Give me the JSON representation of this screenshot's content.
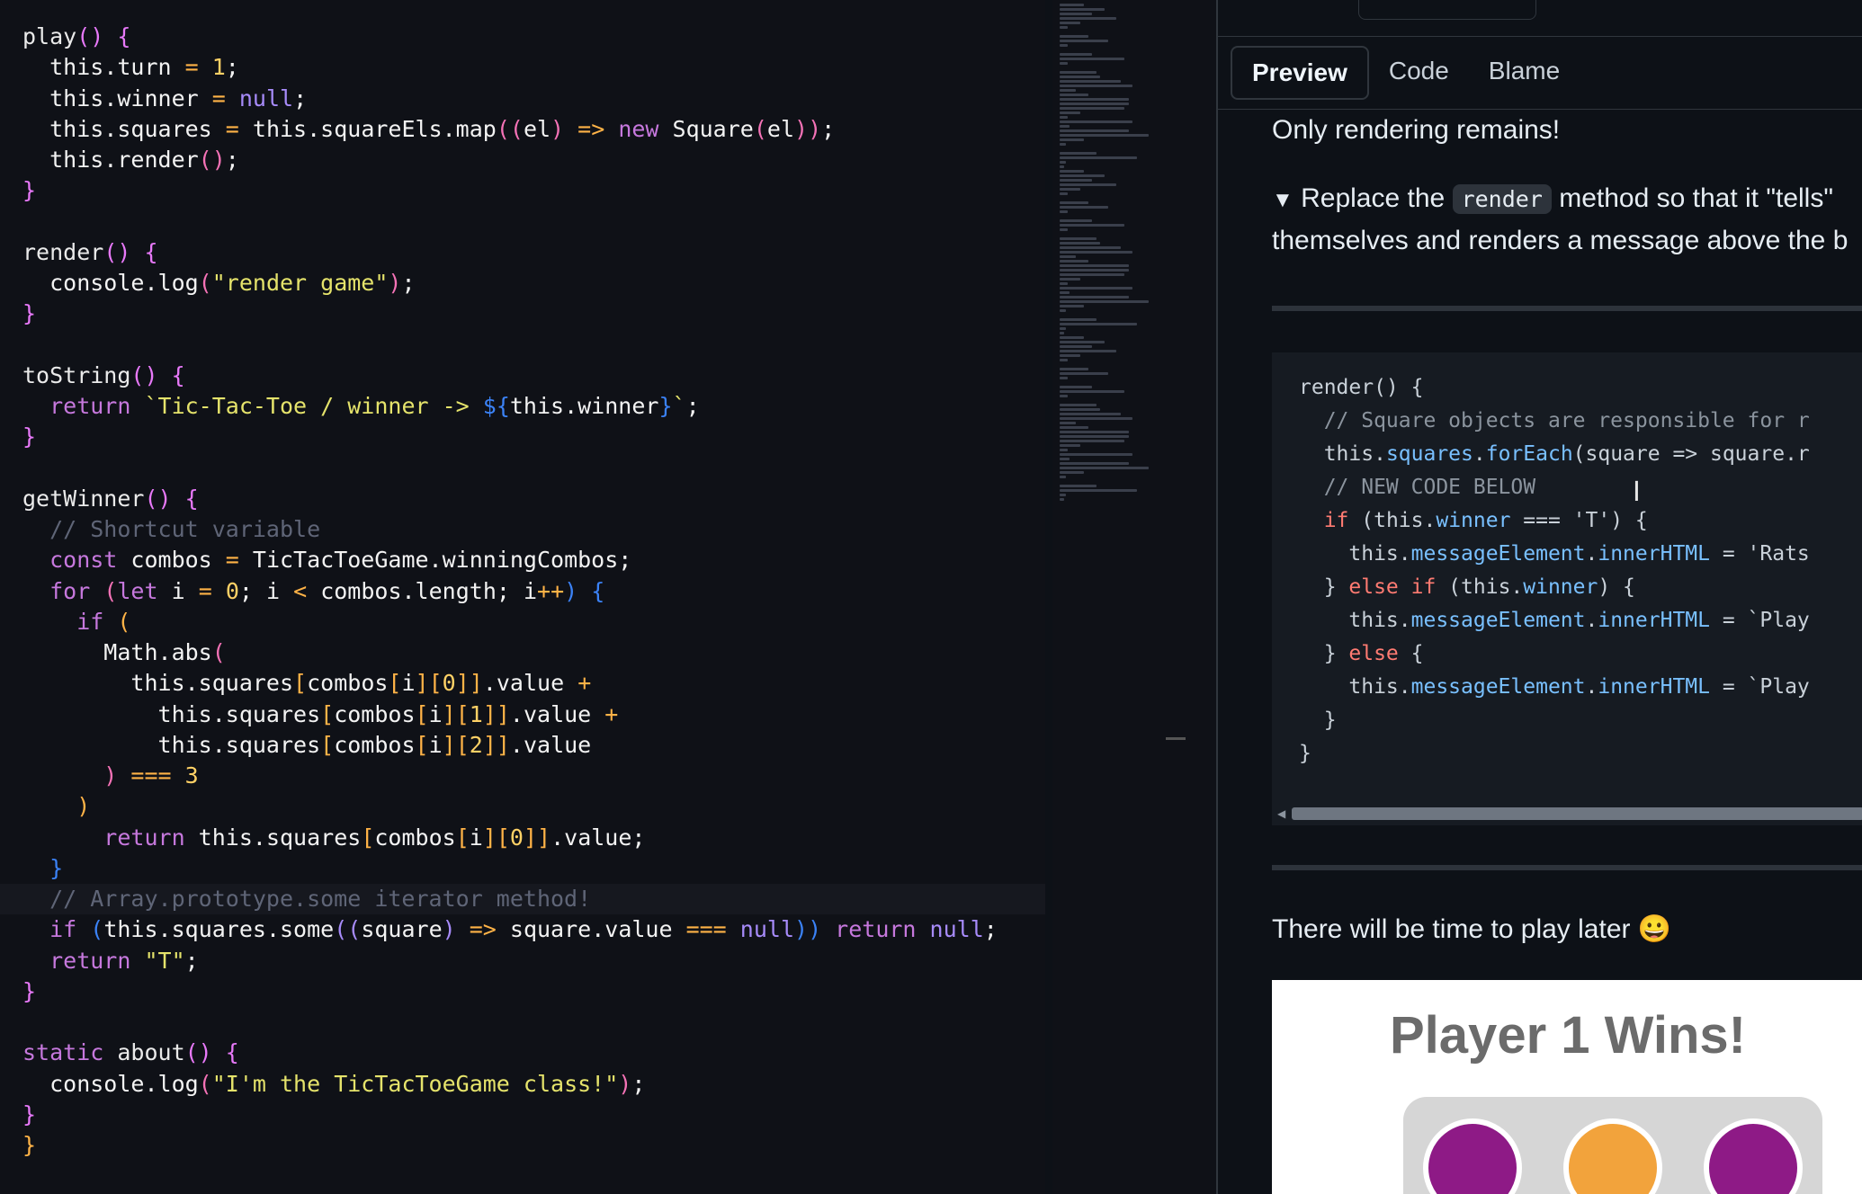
{
  "editor": {
    "lines": [
      [
        {
          "t": "play",
          "c": "f"
        },
        {
          "t": "() {",
          "c": "o"
        }
      ],
      [
        {
          "t": "  this",
          "c": "v"
        },
        {
          "t": ".turn ",
          "c": "v"
        },
        {
          "t": "= ",
          "c": "p"
        },
        {
          "t": "1",
          "c": "n"
        },
        {
          "t": ";",
          "c": "v"
        }
      ],
      [
        {
          "t": "  this",
          "c": "v"
        },
        {
          "t": ".winner ",
          "c": "v"
        },
        {
          "t": "= ",
          "c": "p"
        },
        {
          "t": "null",
          "c": "pu"
        },
        {
          "t": ";",
          "c": "v"
        }
      ],
      [
        {
          "t": "  this",
          "c": "v"
        },
        {
          "t": ".squares ",
          "c": "v"
        },
        {
          "t": "= ",
          "c": "p"
        },
        {
          "t": "this",
          "c": "v"
        },
        {
          "t": ".squareEls.map",
          "c": "v"
        },
        {
          "t": "((",
          "c": "b"
        },
        {
          "t": "el",
          "c": "v"
        },
        {
          "t": ") ",
          "c": "b"
        },
        {
          "t": "=> ",
          "c": "p"
        },
        {
          "t": "new ",
          "c": "k"
        },
        {
          "t": "Square",
          "c": "v"
        },
        {
          "t": "(",
          "c": "b"
        },
        {
          "t": "el",
          "c": "v"
        },
        {
          "t": "))",
          "c": "b"
        },
        {
          "t": ";",
          "c": "v"
        }
      ],
      [
        {
          "t": "  this",
          "c": "v"
        },
        {
          "t": ".render",
          "c": "v"
        },
        {
          "t": "()",
          "c": "b"
        },
        {
          "t": ";",
          "c": "v"
        }
      ],
      [
        {
          "t": "}",
          "c": "o"
        }
      ],
      [],
      [
        {
          "t": "render",
          "c": "f"
        },
        {
          "t": "() {",
          "c": "o"
        }
      ],
      [
        {
          "t": "  console.log",
          "c": "v"
        },
        {
          "t": "(",
          "c": "b"
        },
        {
          "t": "\"render game\"",
          "c": "s"
        },
        {
          "t": ")",
          "c": "b"
        },
        {
          "t": ";",
          "c": "v"
        }
      ],
      [
        {
          "t": "}",
          "c": "o"
        }
      ],
      [],
      [
        {
          "t": "toString",
          "c": "f"
        },
        {
          "t": "() {",
          "c": "o"
        }
      ],
      [
        {
          "t": "  return ",
          "c": "k"
        },
        {
          "t": "`Tic-Tac-Toe / winner -> ",
          "c": "s"
        },
        {
          "t": "${",
          "c": "bb"
        },
        {
          "t": "this.winner",
          "c": "v"
        },
        {
          "t": "}",
          "c": "bb"
        },
        {
          "t": "`",
          "c": "s"
        },
        {
          "t": ";",
          "c": "v"
        }
      ],
      [
        {
          "t": "}",
          "c": "o"
        }
      ],
      [],
      [
        {
          "t": "getWinner",
          "c": "f"
        },
        {
          "t": "() {",
          "c": "o"
        }
      ],
      [
        {
          "t": "  // Shortcut variable",
          "c": "c"
        }
      ],
      [
        {
          "t": "  const ",
          "c": "k"
        },
        {
          "t": "combos ",
          "c": "v"
        },
        {
          "t": "= ",
          "c": "p"
        },
        {
          "t": "TicTacToeGame.winningCombos;",
          "c": "v"
        }
      ],
      [
        {
          "t": "  for ",
          "c": "k"
        },
        {
          "t": "(",
          "c": "b"
        },
        {
          "t": "let ",
          "c": "k"
        },
        {
          "t": "i ",
          "c": "v"
        },
        {
          "t": "= ",
          "c": "p"
        },
        {
          "t": "0",
          "c": "n"
        },
        {
          "t": "; i ",
          "c": "v"
        },
        {
          "t": "< ",
          "c": "p"
        },
        {
          "t": "combos.length; i",
          "c": "v"
        },
        {
          "t": "++",
          "c": "p"
        },
        {
          "t": ") {",
          "c": "bb"
        }
      ],
      [
        {
          "t": "    if ",
          "c": "k"
        },
        {
          "t": "(",
          "c": "p"
        }
      ],
      [
        {
          "t": "      Math.abs",
          "c": "v"
        },
        {
          "t": "(",
          "c": "b"
        }
      ],
      [
        {
          "t": "        this",
          "c": "v"
        },
        {
          "t": ".squares",
          "c": "v"
        },
        {
          "t": "[",
          "c": "p"
        },
        {
          "t": "combos",
          "c": "v"
        },
        {
          "t": "[",
          "c": "p"
        },
        {
          "t": "i",
          "c": "v"
        },
        {
          "t": "][",
          "c": "p"
        },
        {
          "t": "0",
          "c": "n"
        },
        {
          "t": "]]",
          "c": "p"
        },
        {
          "t": ".value ",
          "c": "v"
        },
        {
          "t": "+",
          "c": "p"
        }
      ],
      [
        {
          "t": "          this",
          "c": "v"
        },
        {
          "t": ".squares",
          "c": "v"
        },
        {
          "t": "[",
          "c": "p"
        },
        {
          "t": "combos",
          "c": "v"
        },
        {
          "t": "[",
          "c": "p"
        },
        {
          "t": "i",
          "c": "v"
        },
        {
          "t": "][",
          "c": "p"
        },
        {
          "t": "1",
          "c": "n"
        },
        {
          "t": "]]",
          "c": "p"
        },
        {
          "t": ".value ",
          "c": "v"
        },
        {
          "t": "+",
          "c": "p"
        }
      ],
      [
        {
          "t": "          this",
          "c": "v"
        },
        {
          "t": ".squares",
          "c": "v"
        },
        {
          "t": "[",
          "c": "p"
        },
        {
          "t": "combos",
          "c": "v"
        },
        {
          "t": "[",
          "c": "p"
        },
        {
          "t": "i",
          "c": "v"
        },
        {
          "t": "][",
          "c": "p"
        },
        {
          "t": "2",
          "c": "n"
        },
        {
          "t": "]]",
          "c": "p"
        },
        {
          "t": ".value",
          "c": "v"
        }
      ],
      [
        {
          "t": "      ) ",
          "c": "b"
        },
        {
          "t": "=== ",
          "c": "p"
        },
        {
          "t": "3",
          "c": "n"
        }
      ],
      [
        {
          "t": "    )",
          "c": "p"
        }
      ],
      [
        {
          "t": "      return ",
          "c": "k"
        },
        {
          "t": "this",
          "c": "v"
        },
        {
          "t": ".squares",
          "c": "v"
        },
        {
          "t": "[",
          "c": "p"
        },
        {
          "t": "combos",
          "c": "v"
        },
        {
          "t": "[",
          "c": "p"
        },
        {
          "t": "i",
          "c": "v"
        },
        {
          "t": "][",
          "c": "p"
        },
        {
          "t": "0",
          "c": "n"
        },
        {
          "t": "]]",
          "c": "p"
        },
        {
          "t": ".value;",
          "c": "v"
        }
      ],
      [
        {
          "t": "  }",
          "c": "bb"
        }
      ],
      [
        {
          "t": "  // Array.prototype.some iterator method!",
          "c": "c"
        }
      ],
      [
        {
          "t": "  if ",
          "c": "k"
        },
        {
          "t": "(",
          "c": "bb"
        },
        {
          "t": "this",
          "c": "v"
        },
        {
          "t": ".squares.some",
          "c": "v"
        },
        {
          "t": "((",
          "c": "pu"
        },
        {
          "t": "square",
          "c": "v"
        },
        {
          "t": ") ",
          "c": "pu"
        },
        {
          "t": "=> ",
          "c": "p"
        },
        {
          "t": "square.value ",
          "c": "v"
        },
        {
          "t": "=== ",
          "c": "p"
        },
        {
          "t": "null",
          "c": "pu"
        },
        {
          "t": "))",
          "c": "bb"
        },
        {
          "t": " return ",
          "c": "k"
        },
        {
          "t": "null",
          "c": "pu"
        },
        {
          "t": ";",
          "c": "v"
        }
      ],
      [
        {
          "t": "  return ",
          "c": "k"
        },
        {
          "t": "\"T\"",
          "c": "s"
        },
        {
          "t": ";",
          "c": "v"
        }
      ],
      [
        {
          "t": "}",
          "c": "o"
        }
      ],
      [],
      [
        {
          "t": "static ",
          "c": "k"
        },
        {
          "t": "about",
          "c": "f"
        },
        {
          "t": "() {",
          "c": "o"
        }
      ],
      [
        {
          "t": "  console.log",
          "c": "v"
        },
        {
          "t": "(",
          "c": "b"
        },
        {
          "t": "\"I'm the TicTacToeGame class!\"",
          "c": "s"
        },
        {
          "t": ")",
          "c": "b"
        },
        {
          "t": ";",
          "c": "v"
        }
      ],
      [
        {
          "t": "}",
          "c": "o"
        }
      ],
      [
        {
          "t": "}",
          "c": "p"
        }
      ]
    ]
  },
  "panel": {
    "tabs": [
      "Preview",
      "Code",
      "Blame"
    ],
    "active_tab": "Preview",
    "intro": "Only rendering remains!",
    "details_line1_pre": "Replace the ",
    "details_code": "render",
    "details_line1_post": " method so that it \"tells\"",
    "details_line2": "themselves and renders a message above the b",
    "code_lines": [
      [
        {
          "t": "render() {",
          "c": ""
        }
      ],
      [
        {
          "t": "  // Square objects are responsible for r",
          "c": "cm"
        }
      ],
      [
        {
          "t": "  this.",
          "c": ""
        },
        {
          "t": "squares",
          "c": "pr"
        },
        {
          "t": ".",
          "c": ""
        },
        {
          "t": "forEach",
          "c": "pr"
        },
        {
          "t": "(square => square.r",
          "c": ""
        }
      ],
      [
        {
          "t": "  // NEW CODE BELOW",
          "c": "cm"
        }
      ],
      [
        {
          "t": "  ",
          "c": ""
        },
        {
          "t": "if",
          "c": "kw"
        },
        {
          "t": " (this.",
          "c": ""
        },
        {
          "t": "winner",
          "c": "pr"
        },
        {
          "t": " === 'T') {",
          "c": ""
        }
      ],
      [
        {
          "t": "    this.",
          "c": ""
        },
        {
          "t": "messageElement",
          "c": "pr"
        },
        {
          "t": ".",
          "c": ""
        },
        {
          "t": "innerHTML",
          "c": "pr"
        },
        {
          "t": " = 'Rats",
          "c": ""
        }
      ],
      [
        {
          "t": "  } ",
          "c": ""
        },
        {
          "t": "else if",
          "c": "kw"
        },
        {
          "t": " (this.",
          "c": ""
        },
        {
          "t": "winner",
          "c": "pr"
        },
        {
          "t": ") {",
          "c": ""
        }
      ],
      [
        {
          "t": "    this.",
          "c": ""
        },
        {
          "t": "messageElement",
          "c": "pr"
        },
        {
          "t": ".",
          "c": ""
        },
        {
          "t": "innerHTML",
          "c": "pr"
        },
        {
          "t": " = `Play",
          "c": ""
        }
      ],
      [
        {
          "t": "  } ",
          "c": ""
        },
        {
          "t": "else",
          "c": "kw"
        },
        {
          "t": " {",
          "c": ""
        }
      ],
      [
        {
          "t": "    this.",
          "c": ""
        },
        {
          "t": "messageElement",
          "c": "pr"
        },
        {
          "t": ".",
          "c": ""
        },
        {
          "t": "innerHTML",
          "c": "pr"
        },
        {
          "t": " = `Play",
          "c": ""
        }
      ],
      [
        {
          "t": "  }",
          "c": ""
        }
      ],
      [
        {
          "t": "}",
          "c": ""
        }
      ]
    ],
    "play_later": "There will be time to play later 😀",
    "game_title": "Player 1 Wins!",
    "discs": [
      "#8e1a86",
      "#f2a33c",
      "#8e1a86"
    ]
  }
}
